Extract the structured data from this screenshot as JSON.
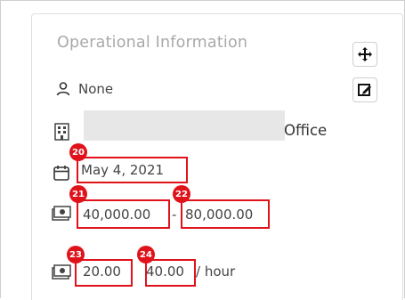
{
  "section": {
    "title": "Operational Information"
  },
  "toolbar": {
    "move_icon": "move-arrows-icon",
    "edit_icon": "edit-pencil-icon"
  },
  "fields": {
    "owner": "None",
    "office_suffix": "Office",
    "date": "May 4, 2021",
    "salary_min": "40,000.00",
    "salary_separator": "-",
    "salary_max": "80,000.00",
    "rate_min": "20.00",
    "rate_max": "40.00",
    "rate_unit": "/ hour"
  },
  "markers": {
    "date": "20",
    "salary_min": "21",
    "salary_max": "22",
    "rate_min": "23",
    "rate_max": "24"
  },
  "colors": {
    "marker": "#e0131b",
    "title": "#a9a9a9"
  }
}
